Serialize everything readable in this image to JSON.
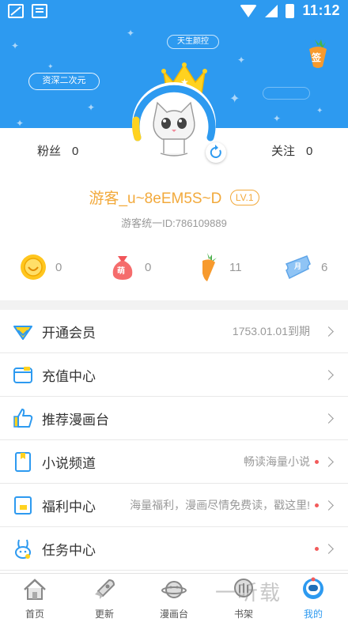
{
  "status_bar": {
    "time": "11:12"
  },
  "header": {
    "top_tag": "天生颜控",
    "left_tag": "资深二次元",
    "sign_label": "签",
    "avatar_badge": "♚"
  },
  "stats": {
    "fans_label": "粉丝",
    "fans_value": "0",
    "follow_label": "关注",
    "follow_value": "0"
  },
  "user": {
    "name": "游客_u~8eEM5S~D",
    "level": "LV.1",
    "uid": "游客统一ID:786109889"
  },
  "assets": [
    {
      "icon": "coin-icon",
      "value": "0"
    },
    {
      "icon": "cute-bag-icon",
      "value": "0",
      "glyph": "萌"
    },
    {
      "icon": "carrot-icon",
      "value": "11"
    },
    {
      "icon": "ticket-icon",
      "value": "6",
      "glyph": "月"
    }
  ],
  "menu": [
    {
      "icon": "vip-diamond-icon",
      "label": "开通会员",
      "detail": "1753.01.01到期",
      "dot": false
    },
    {
      "icon": "wallet-icon",
      "label": "充值中心",
      "detail": "",
      "dot": false
    },
    {
      "icon": "thumbs-up-icon",
      "label": "推荐漫画台",
      "detail": "",
      "dot": false
    },
    {
      "icon": "book-icon",
      "label": "小说频道",
      "detail": "畅读海量小说",
      "dot": true
    },
    {
      "icon": "gift-icon",
      "label": "福利中心",
      "detail": "海量福利，漫画尽情免费读，戳这里!",
      "dot": true
    },
    {
      "icon": "rabbit-icon",
      "label": "任务中心",
      "detail": "",
      "dot": true
    }
  ],
  "bottom_nav": [
    {
      "icon": "home-icon",
      "label": "首页",
      "active": false
    },
    {
      "icon": "rocket-icon",
      "label": "更新",
      "active": false
    },
    {
      "icon": "planet-icon",
      "label": "漫画台",
      "active": false
    },
    {
      "icon": "bookshelf-icon",
      "label": "书架",
      "active": false
    },
    {
      "icon": "astronaut-icon",
      "label": "我的",
      "active": true
    }
  ],
  "watermark": "一听载",
  "colors": {
    "brand_blue": "#2d9af0",
    "gold": "#f2a93b",
    "dot_red": "#f25b5b"
  }
}
